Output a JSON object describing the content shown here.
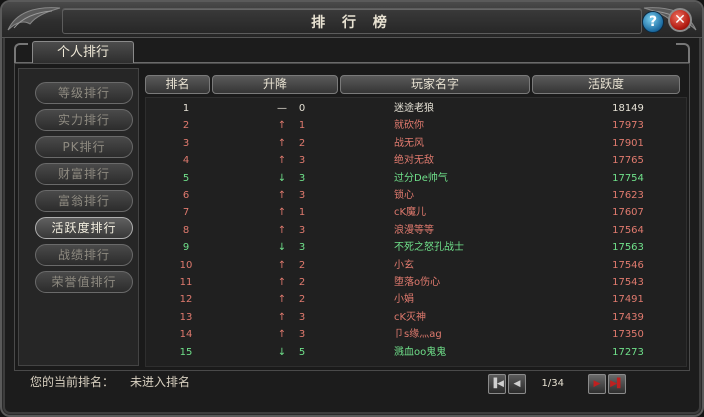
{
  "window": {
    "title": "排 行 榜"
  },
  "controls": {
    "help_label": "?",
    "close_label": "✕"
  },
  "tabs": [
    {
      "label": "个人排行"
    }
  ],
  "sidebar": {
    "items": [
      {
        "label": "等级排行",
        "active": false
      },
      {
        "label": "实力排行",
        "active": false
      },
      {
        "label": "PK排行",
        "active": false
      },
      {
        "label": "财富排行",
        "active": false
      },
      {
        "label": "富翁排行",
        "active": false
      },
      {
        "label": "活跃度排行",
        "active": true
      },
      {
        "label": "战绩排行",
        "active": false
      },
      {
        "label": "荣誉值排行",
        "active": false
      }
    ]
  },
  "table": {
    "headers": [
      "排名",
      "升降",
      "玩家名字",
      "活跃度"
    ],
    "rows": [
      {
        "rank": "1",
        "arrow": "—",
        "delta": "0",
        "name": "迷途老狼",
        "score": "18149",
        "color": "white"
      },
      {
        "rank": "2",
        "arrow": "↑",
        "delta": "1",
        "name": "就砍你",
        "score": "17973",
        "color": "red"
      },
      {
        "rank": "3",
        "arrow": "↑",
        "delta": "2",
        "name": "战无风",
        "score": "17901",
        "color": "red"
      },
      {
        "rank": "4",
        "arrow": "↑",
        "delta": "3",
        "name": "绝对无敌",
        "score": "17765",
        "color": "red"
      },
      {
        "rank": "5",
        "arrow": "↓",
        "delta": "3",
        "name": "过分De帅气",
        "score": "17754",
        "color": "green"
      },
      {
        "rank": "6",
        "arrow": "↑",
        "delta": "3",
        "name": "锁心",
        "score": "17623",
        "color": "red"
      },
      {
        "rank": "7",
        "arrow": "↑",
        "delta": "1",
        "name": "cK魔儿",
        "score": "17607",
        "color": "red"
      },
      {
        "rank": "8",
        "arrow": "↑",
        "delta": "3",
        "name": "浪漫等等",
        "score": "17564",
        "color": "red"
      },
      {
        "rank": "9",
        "arrow": "↓",
        "delta": "3",
        "name": "不死之怒孔战士",
        "score": "17563",
        "color": "green"
      },
      {
        "rank": "10",
        "arrow": "↑",
        "delta": "2",
        "name": "小玄",
        "score": "17546",
        "color": "red"
      },
      {
        "rank": "11",
        "arrow": "↑",
        "delta": "2",
        "name": "堕落o伤心",
        "score": "17543",
        "color": "red"
      },
      {
        "rank": "12",
        "arrow": "↑",
        "delta": "2",
        "name": "小娟",
        "score": "17491",
        "color": "red"
      },
      {
        "rank": "13",
        "arrow": "↑",
        "delta": "3",
        "name": "cK灭神",
        "score": "17439",
        "color": "red"
      },
      {
        "rank": "14",
        "arrow": "↑",
        "delta": "3",
        "name": "卩s缘灬ag",
        "score": "17350",
        "color": "red"
      },
      {
        "rank": "15",
        "arrow": "↓",
        "delta": "5",
        "name": "溅血oo鬼鬼",
        "score": "17273",
        "color": "green"
      }
    ]
  },
  "footer": {
    "current_rank_label": "您的当前排名：",
    "current_rank_value": "未进入排名"
  },
  "pager": {
    "first": "▐◀",
    "prev": "◀",
    "page": "1/34",
    "next": "▶",
    "last": "▶▌"
  },
  "colors": {
    "white": "#e6e2d6",
    "red": "#e07a6e",
    "green": "#6fe08a"
  }
}
